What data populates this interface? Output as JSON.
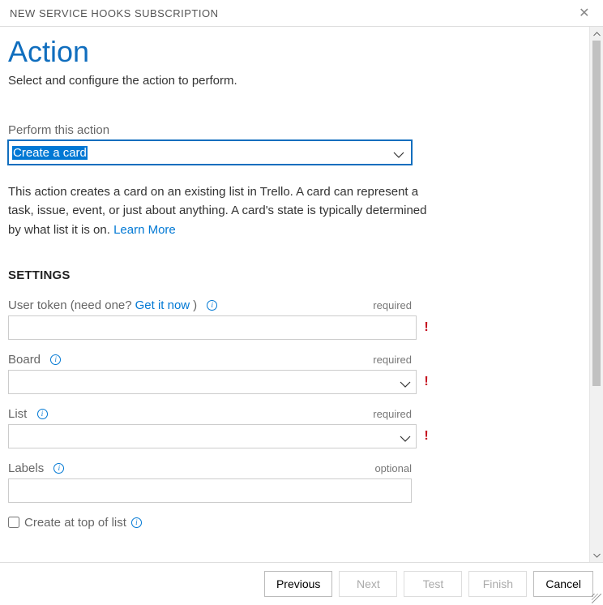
{
  "header": {
    "title": "NEW SERVICE HOOKS SUBSCRIPTION"
  },
  "page": {
    "title": "Action",
    "subtitle": "Select and configure the action to perform."
  },
  "action": {
    "label": "Perform this action",
    "selected": "Create a card",
    "description_pre": "This action creates a card on an existing list in Trello. A card can represent a task, issue, event, or just about anything. A card's state is typically determined by what list it is on. ",
    "learn_more": "Learn More"
  },
  "settings": {
    "header": "SETTINGS",
    "required": "required",
    "optional": "optional",
    "user_token": {
      "label_pre": "User token (need one? ",
      "link": "Get it now",
      "label_post": ")",
      "value": "",
      "error": true
    },
    "board": {
      "label": "Board",
      "value": "",
      "error": true
    },
    "list": {
      "label": "List",
      "value": "",
      "error": true
    },
    "labels": {
      "label": "Labels",
      "value": "",
      "error": false
    },
    "create_top": {
      "label": "Create at top of list",
      "checked": false
    }
  },
  "footer": {
    "previous": "Previous",
    "next": "Next",
    "test": "Test",
    "finish": "Finish",
    "cancel": "Cancel",
    "next_enabled": false,
    "test_enabled": false,
    "finish_enabled": false
  }
}
